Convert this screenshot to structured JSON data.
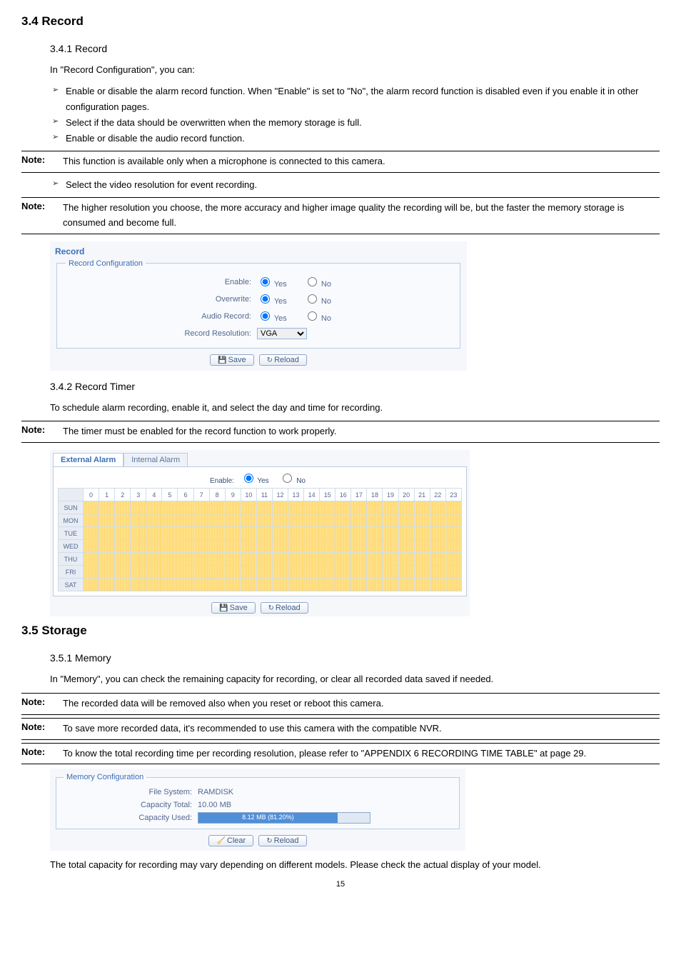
{
  "section_record": {
    "heading": "3.4 Record",
    "sub1": {
      "heading": "3.4.1 Record",
      "intro": "In \"Record Configuration\", you can:",
      "bullets": [
        "Enable or disable the alarm record function. When \"Enable\" is set to \"No\", the alarm record function is disabled even if you enable it in other configuration pages.",
        "Select if the data should be overwritten when the memory storage is full.",
        "Enable or disable the audio record function."
      ],
      "note1": "This function is available only when a microphone is connected to this camera.",
      "bullet_after": "Select the video resolution for event recording.",
      "note2": "The higher resolution you choose, the more accuracy and higher image quality the recording will be, but the faster the memory storage is consumed and become full."
    },
    "sub2": {
      "heading": "3.4.2 Record Timer",
      "intro": "To schedule alarm recording, enable it, and select the day and time for recording.",
      "note": "The timer must be enabled for the record function to work properly."
    }
  },
  "section_storage": {
    "heading": "3.5 Storage",
    "sub1": {
      "heading": "3.5.1 Memory",
      "intro": "In \"Memory\", you can check the remaining capacity for recording, or clear all recorded data saved if needed.",
      "note1": "The recorded data will be removed also when you reset or reboot this camera.",
      "note2": "To save more recorded data, it's recommended to use this camera with the compatible NVR.",
      "note3": "To know the total recording time per recording resolution, please refer to \"APPENDIX 6 RECORDING TIME TABLE\" at page 29.",
      "tail": "The total capacity for recording may vary depending on different models. Please check the actual display of your model."
    }
  },
  "record_panel": {
    "title": "Record",
    "legend": "Record Configuration",
    "rows": {
      "enable_lbl": "Enable:",
      "overwrite_lbl": "Overwrite:",
      "audio_lbl": "Audio Record:",
      "res_lbl": "Record Resolution:",
      "yes": "Yes",
      "no": "No",
      "res_value": "VGA"
    },
    "save_btn": "Save",
    "reload_btn": "Reload"
  },
  "timer_panel": {
    "tab_external": "External Alarm",
    "tab_internal": "Internal Alarm",
    "enable_lbl": "Enable:",
    "yes": "Yes",
    "no": "No",
    "days": [
      "SUN",
      "MON",
      "TUE",
      "WED",
      "THU",
      "FRI",
      "SAT"
    ],
    "hours": [
      "0",
      "1",
      "2",
      "3",
      "4",
      "5",
      "6",
      "7",
      "8",
      "9",
      "10",
      "11",
      "12",
      "13",
      "14",
      "15",
      "16",
      "17",
      "18",
      "19",
      "20",
      "21",
      "22",
      "23"
    ],
    "save_btn": "Save",
    "reload_btn": "Reload"
  },
  "memory_panel": {
    "legend": "Memory Configuration",
    "fs_lbl": "File System:",
    "fs_val": "RAMDISK",
    "total_lbl": "Capacity Total:",
    "total_val": "10.00 MB",
    "used_lbl": "Capacity Used:",
    "used_text": "8.12 MB (81.20%)",
    "used_pct": 81.2,
    "clear_btn": "Clear",
    "reload_btn": "Reload"
  },
  "note_label": "Note:",
  "page_num": "15"
}
